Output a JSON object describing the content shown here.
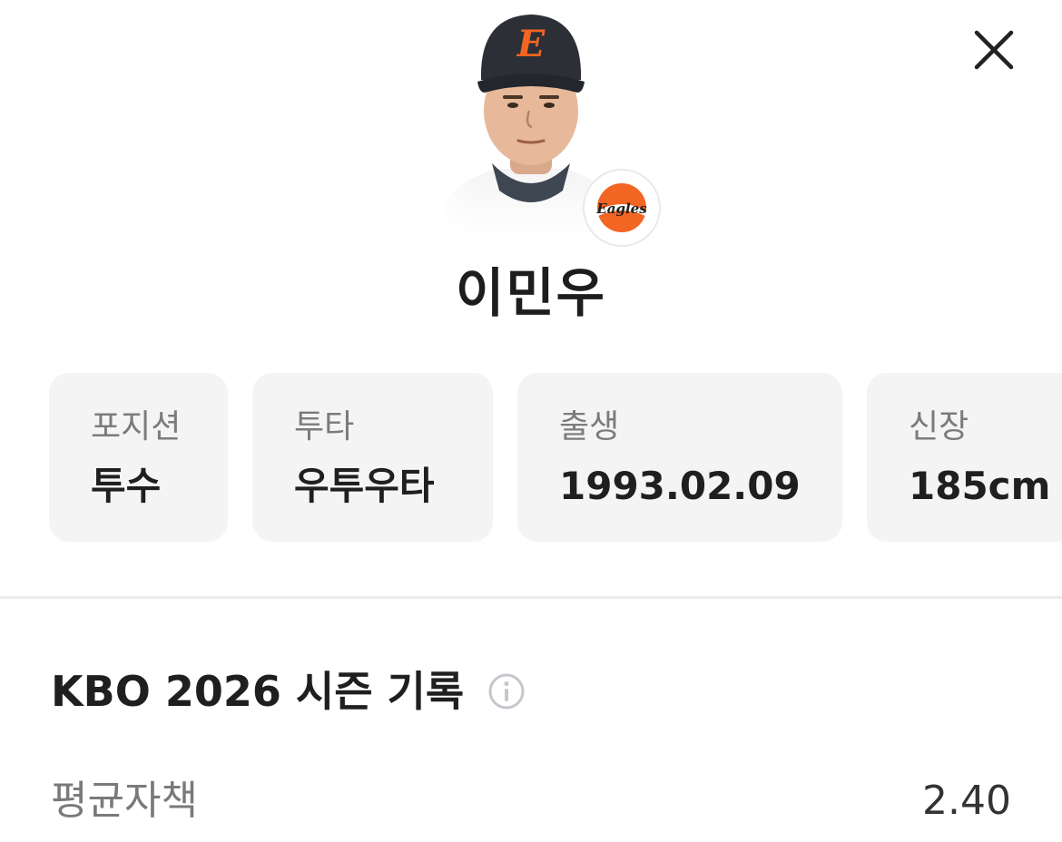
{
  "player": {
    "name": "이민우",
    "photo_alt": "player-photo",
    "team_logo_text": "Eagles",
    "cap_letter": "E"
  },
  "info_cards": [
    {
      "label": "포지션",
      "value": "투수"
    },
    {
      "label": "투타",
      "value": "우투우타"
    },
    {
      "label": "출생",
      "value": "1993.02.09"
    },
    {
      "label": "신장",
      "value": "185cm"
    }
  ],
  "season": {
    "title": "KBO 2026 시즌 기록",
    "stats": [
      {
        "label": "평균자책",
        "value": "2.40"
      }
    ]
  },
  "colors": {
    "card_bg": "#f4f4f5",
    "accent_orange": "#f26522",
    "icon_gray": "#c4c8cc"
  }
}
